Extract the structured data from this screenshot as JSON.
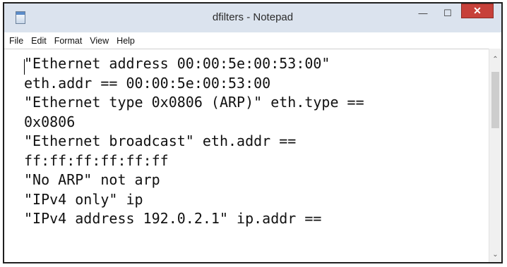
{
  "window": {
    "title": "dfilters - Notepad",
    "icons": {
      "app": "notepad-icon",
      "minimize": "minimize-icon",
      "maximize": "maximize-icon",
      "close": "close-icon"
    },
    "close_color": "#c7413a"
  },
  "menu": [
    "File",
    "Edit",
    "Format",
    "View",
    "Help"
  ],
  "editor": {
    "lines": [
      "\"Ethernet address 00:00:5e:00:53:00\"",
      "eth.addr == 00:00:5e:00:53:00",
      "\"Ethernet type 0x0806 (ARP)\" eth.type ==",
      "0x0806",
      "\"Ethernet broadcast\" eth.addr ==",
      "ff:ff:ff:ff:ff:ff",
      "\"No ARP\" not arp",
      "\"IPv4 only\" ip",
      "\"IPv4 address 192.0.2.1\" ip.addr =="
    ]
  },
  "scrollbar": {
    "up_icon": "chevron-up-icon",
    "down_icon": "chevron-down-icon"
  }
}
